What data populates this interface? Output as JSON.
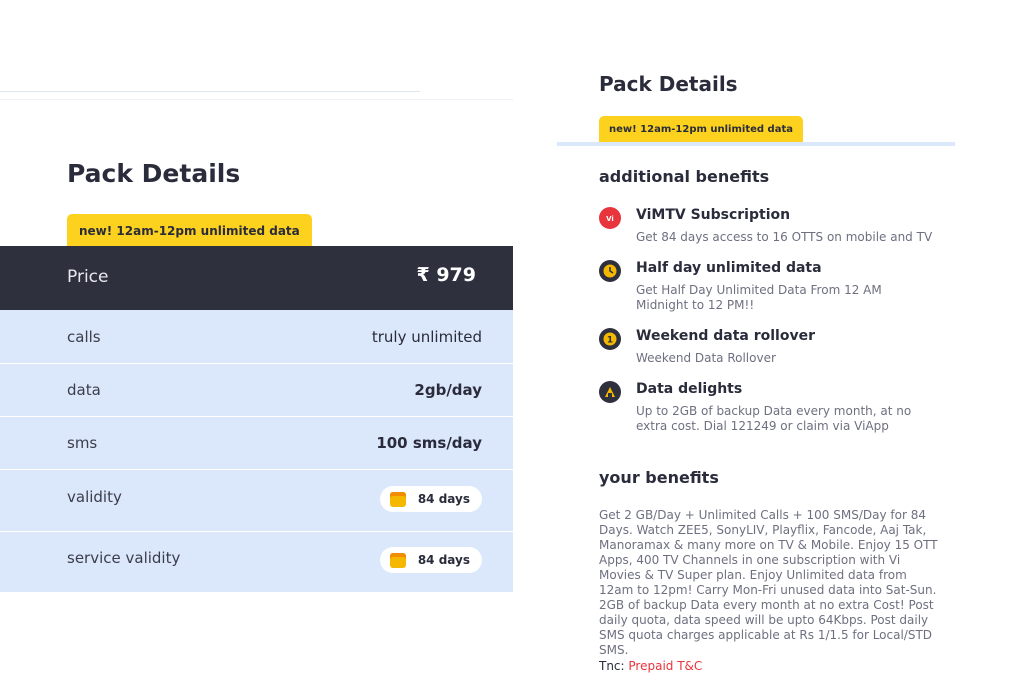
{
  "left": {
    "title": "Pack Details",
    "badge": "new! 12am-12pm unlimited data",
    "price_label": "Price",
    "price_value": "₹ 979",
    "rows": [
      {
        "label": "calls",
        "value": "truly unlimited"
      },
      {
        "label": "data",
        "value": "2gb/day"
      },
      {
        "label": "sms",
        "value": "100 sms/day"
      },
      {
        "label": "validity",
        "value": "84 days",
        "icon": "calendar-icon"
      },
      {
        "label": "service validity",
        "value": "84 days",
        "icon": "calendar-icon"
      }
    ]
  },
  "right": {
    "title": "Pack Details",
    "badge": "new! 12am-12pm unlimited data",
    "additional_title": "additional benefits",
    "benefits": [
      {
        "icon": "vimtv-icon",
        "title": "ViMTV Subscription",
        "desc": "Get 84 days access to 16 OTTS on mobile and TV"
      },
      {
        "icon": "clock-icon",
        "title": "Half day unlimited data",
        "desc": "Get Half Day Unlimited Data From 12 AM Midnight to 12 PM!!"
      },
      {
        "icon": "rollover-icon",
        "title": "Weekend data rollover",
        "desc": "Weekend Data Rollover"
      },
      {
        "icon": "data-delights-icon",
        "title": "Data delights",
        "desc": "Up to 2GB of backup Data every month, at no extra cost. Dial 121249 or claim via ViApp"
      }
    ],
    "your_benefits_title": "your benefits",
    "your_benefits_text": "Get 2 GB/Day + Unlimited Calls + 100 SMS/Day for 84 Days. Watch ZEE5, SonyLIV, Playflix, Fancode, Aaj Tak, Manoramax & many more on TV & Mobile. Enjoy 15 OTT Apps, 400 TV Channels in one subscription with Vi Movies & TV Super plan. Enjoy Unlimited data from 12am to 12pm! Carry Mon-Fri unused data into Sat-Sun. 2GB of backup Data every month at no extra Cost! Post daily quota, data speed will be upto 64Kbps. Post daily SMS quota charges applicable at Rs 1/1.5 for Local/STD SMS.",
    "tnc_label": "Tnc:",
    "tnc_link": "Prepaid T&C"
  },
  "colors": {
    "badge": "#fcd21e",
    "dark_row": "#2e303e",
    "light_rows": "#dbe7fa",
    "link": "#e8343c"
  }
}
